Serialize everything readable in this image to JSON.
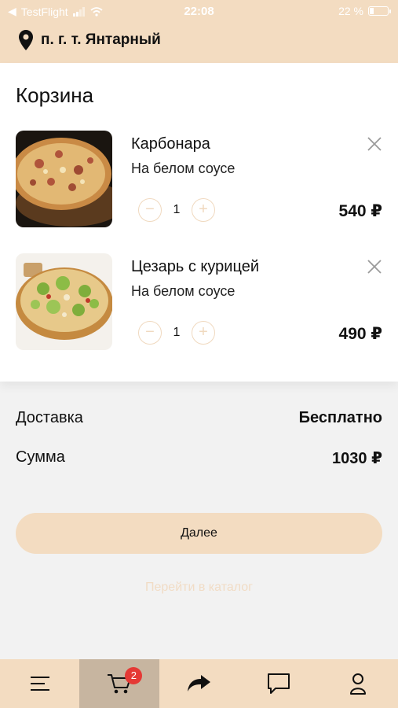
{
  "status_bar": {
    "carrier": "TestFlight",
    "time": "22:08",
    "battery": "22 %"
  },
  "header": {
    "location": "п. г. т. Янтарный"
  },
  "cart": {
    "title": "Корзина",
    "items": [
      {
        "name": "Карбонара",
        "sauce": "На белом соусе",
        "qty": "1",
        "price": "540 ₽"
      },
      {
        "name": "Цезарь с курицей",
        "sauce": "На белом соусе",
        "qty": "1",
        "price": "490 ₽"
      }
    ]
  },
  "summary": {
    "delivery_label": "Доставка",
    "delivery_value": "Бесплатно",
    "total_label": "Сумма",
    "total_value": "1030 ₽"
  },
  "actions": {
    "next": "Далее",
    "catalog": "Перейти в каталог"
  },
  "tabbar": {
    "cart_badge": "2"
  },
  "colors": {
    "accent": "#f3dcc1",
    "tab_active": "#c7b5a0",
    "badge": "#e53935"
  }
}
